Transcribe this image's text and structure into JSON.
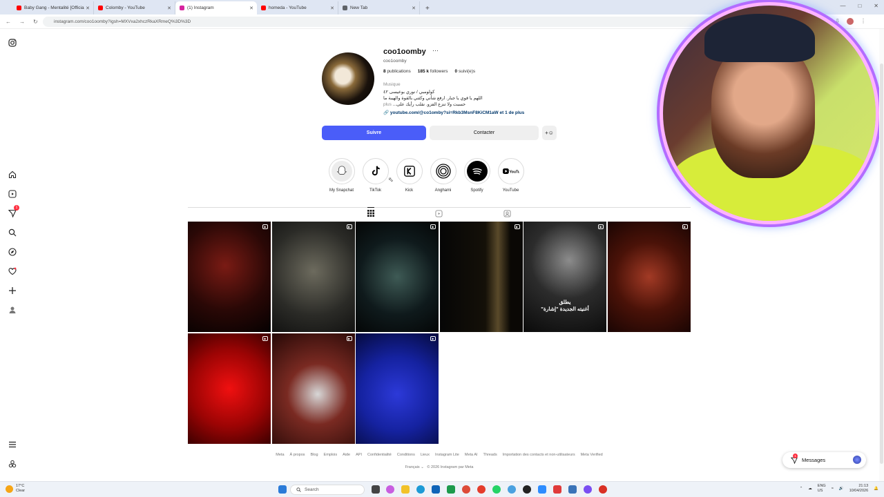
{
  "browser": {
    "tabs": [
      {
        "label": "Baby Gang - Mentalité [Officia",
        "favicon": "#ff0000"
      },
      {
        "label": "Colomby - YouTube",
        "favicon": "#ff0000"
      },
      {
        "label": "(1) Instagram",
        "favicon": "#d6249f"
      },
      {
        "label": "homeda - YouTube",
        "favicon": "#ff0000"
      },
      {
        "label": "New Tab",
        "favicon": "#5f6368"
      }
    ],
    "url": "instagram.com/coo1oomby?igsh=MXVxa2xhczRkaXRmeQ%3D%3D"
  },
  "profile": {
    "username": "coo1oomby",
    "handle": "coo1oomby",
    "posts_count": "8",
    "posts_label": "publications",
    "followers_count": "185 k",
    "followers_label": "followers",
    "following_count": "0",
    "following_label": "suivi(e)s",
    "category": "Musique",
    "bio_line1": "كولومبي / نوري بوعيسى ٤٢",
    "bio_line2": "اللهم يا قوي يا جبار. ارفع شأني وكثني بالقوة والهيبة ما",
    "bio_line3": "حسبت ولا تنزع الفزو. نقلب رأيك على...",
    "bio_more": "plus",
    "link_text": "youtube.com/@co1omby?si=Rkb3MsnF8KiCM1aW et 1 de plus",
    "follow_label": "Suivre",
    "contact_label": "Contacter"
  },
  "highlights": [
    {
      "label": "My Snapchat",
      "icon": "snapchat-ghost",
      "bg": "#ececec",
      "color": "#ffffff"
    },
    {
      "label": "TikTok",
      "icon": "tiktok-note",
      "bg": "#ffffff",
      "color": "#000000"
    },
    {
      "label": "Kick",
      "icon": "kick-k",
      "bg": "#ffffff",
      "color": "#000000"
    },
    {
      "label": "Anghami",
      "icon": "anghami-rings",
      "bg": "#ffffff",
      "color": "#000000"
    },
    {
      "label": "Spotify",
      "icon": "spotify",
      "bg": "#000000",
      "color": "#ffffff"
    },
    {
      "label": "YouTube",
      "icon": "youtube",
      "bg": "#ffffff",
      "color": "#000000"
    }
  ],
  "posts": [
    {
      "bg": "radial-gradient(circle at 45% 40%,#7a1b14 0%,#2a0806 55%,#050101 100%)",
      "caption": ""
    },
    {
      "bg": "radial-gradient(circle at 50% 45%,#6d6b5e 0%,#2b2b27 60%,#121211 100%)",
      "caption": ""
    },
    {
      "bg": "radial-gradient(circle at 50% 50%,#3e5a55 0%,#0f1a1c 55%,#040606 100%)",
      "caption": ""
    },
    {
      "bg": "linear-gradient(90deg,#060606 0%,#141008 55%,#5a4a2a 70%,#0a0805 85%)",
      "caption": ""
    },
    {
      "bg": "radial-gradient(circle at 55% 35%,#8c8c8c 0%,#2c2c2c 45%,#0a0a0a 100%)",
      "caption": "يطلق\nأغنيته الجديدة \"إشارة\""
    },
    {
      "bg": "radial-gradient(circle at 50% 50%,#a23a25 0%,#4a1208 50%,#1a0503 100%)",
      "caption": ""
    },
    {
      "bg": "radial-gradient(circle at 50% 50%,#f01010 0%,#9c0404 55%,#3d0000 100%)",
      "caption": ""
    },
    {
      "bg": "radial-gradient(circle at 55% 55%,#d7d7d7 0%,#7a2a22 40%,#250806 100%)",
      "caption": ""
    },
    {
      "bg": "radial-gradient(circle at 50% 55%,#2c39d8 0%,#1522a0 50%,#050a3d 100%)",
      "caption": ""
    }
  ],
  "footer": {
    "links": [
      "Meta",
      "À propos",
      "Blog",
      "Emplois",
      "Aide",
      "API",
      "Confidentialité",
      "Conditions",
      "Lieux",
      "Instagram Lite",
      "Meta AI",
      "Threads",
      "Importation des contacts et non-utilisateurs",
      "Meta Verified"
    ],
    "language": "Français",
    "copyright": "© 2026 Instagram par Meta"
  },
  "messages": {
    "label": "Messages",
    "badge": "1"
  },
  "nav": {
    "notifications_badge": "1"
  },
  "taskbar": {
    "temp": "17°C",
    "condition": "Clear",
    "search_placeholder": "Search",
    "lang1": "ENG",
    "lang2": "US",
    "time": "21:13",
    "date": "10/04/2026"
  }
}
